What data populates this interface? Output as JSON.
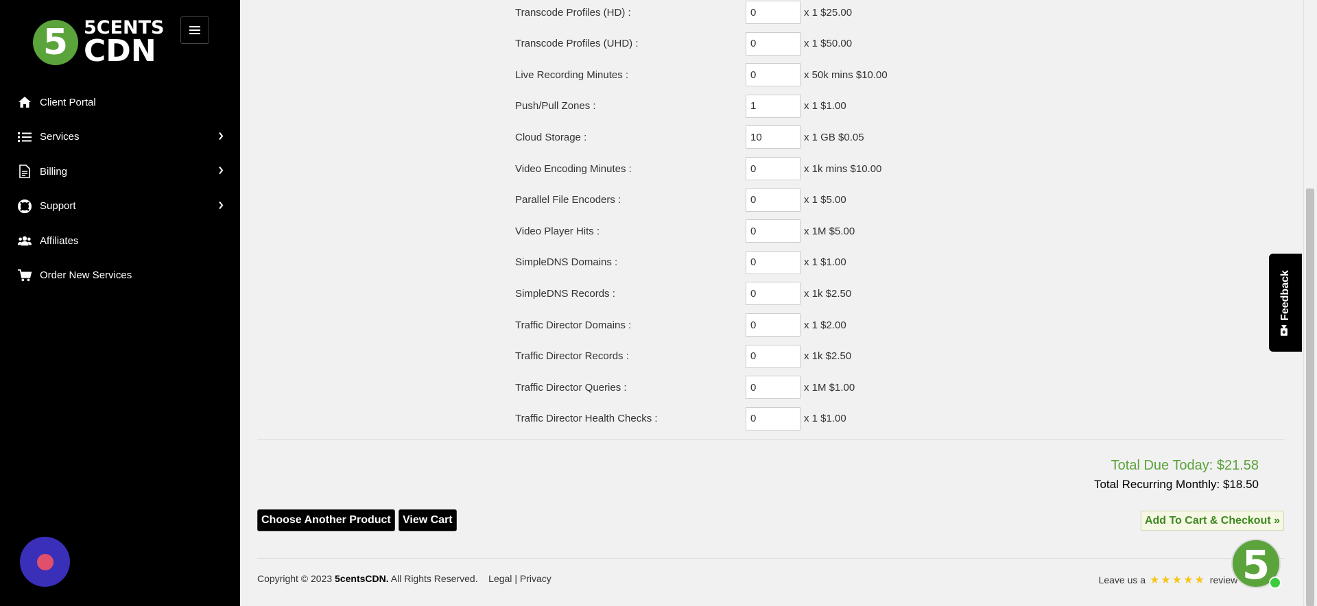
{
  "sidebar": {
    "logo": {
      "mark": "5",
      "line1": "5CENTS",
      "line2": "CDN"
    },
    "items": [
      {
        "label": "Client Portal",
        "icon": "home-icon",
        "has_submenu": false
      },
      {
        "label": "Services",
        "icon": "list-icon",
        "has_submenu": true
      },
      {
        "label": "Billing",
        "icon": "document-icon",
        "has_submenu": true
      },
      {
        "label": "Support",
        "icon": "lifebuoy-icon",
        "has_submenu": true
      },
      {
        "label": "Affiliates",
        "icon": "users-icon",
        "has_submenu": false
      },
      {
        "label": "Order New Services",
        "icon": "cart-icon",
        "has_submenu": false
      }
    ]
  },
  "options": [
    {
      "label": "Transcode Profiles (HD) :",
      "value": "0",
      "price": "x 1 $25.00"
    },
    {
      "label": "Transcode Profiles (UHD) :",
      "value": "0",
      "price": "x 1 $50.00"
    },
    {
      "label": "Live Recording Minutes :",
      "value": "0",
      "price": "x 50k mins $10.00"
    },
    {
      "label": "Push/Pull Zones :",
      "value": "1",
      "price": "x 1 $1.00"
    },
    {
      "label": "Cloud Storage :",
      "value": "10",
      "price": "x 1 GB $0.05"
    },
    {
      "label": "Video Encoding Minutes :",
      "value": "0",
      "price": "x 1k mins $10.00"
    },
    {
      "label": "Parallel File Encoders :",
      "value": "0",
      "price": "x 1 $5.00"
    },
    {
      "label": "Video Player Hits :",
      "value": "0",
      "price": "x 1M $5.00"
    },
    {
      "label": "SimpleDNS Domains :",
      "value": "0",
      "price": "x 1 $1.00"
    },
    {
      "label": "SimpleDNS Records :",
      "value": "0",
      "price": "x 1k $2.50"
    },
    {
      "label": "Traffic Director Domains :",
      "value": "0",
      "price": "x 1 $2.00"
    },
    {
      "label": "Traffic Director Records :",
      "value": "0",
      "price": "x 1k $2.50"
    },
    {
      "label": "Traffic Director Queries :",
      "value": "0",
      "price": "x 1M $1.00"
    },
    {
      "label": "Traffic Director Health Checks :",
      "value": "0",
      "price": "x 1 $1.00"
    }
  ],
  "totals": {
    "due_today": "Total Due Today: $21.58",
    "recurring": "Total Recurring Monthly: $18.50"
  },
  "buttons": {
    "choose_another": "Choose Another Product",
    "view_cart": "View Cart",
    "add_to_cart": "Add To Cart & Checkout »"
  },
  "footer": {
    "copyright": "Copyright © 2023",
    "brand": "5centsCDN.",
    "rights": "All Rights Reserved.",
    "legal": "Legal",
    "sep": "|",
    "privacy": "Privacy",
    "review_prefix": "Leave us a",
    "stars": "★★★★★",
    "review_suffix": "review",
    "review_sep": "|"
  },
  "feedback": {
    "label": "Feedback"
  },
  "brand_bubble": {
    "mark": "5"
  },
  "colors": {
    "accent": "#5ba33b",
    "sidebar_bg": "#000000",
    "chat": "#3a2fb8"
  }
}
